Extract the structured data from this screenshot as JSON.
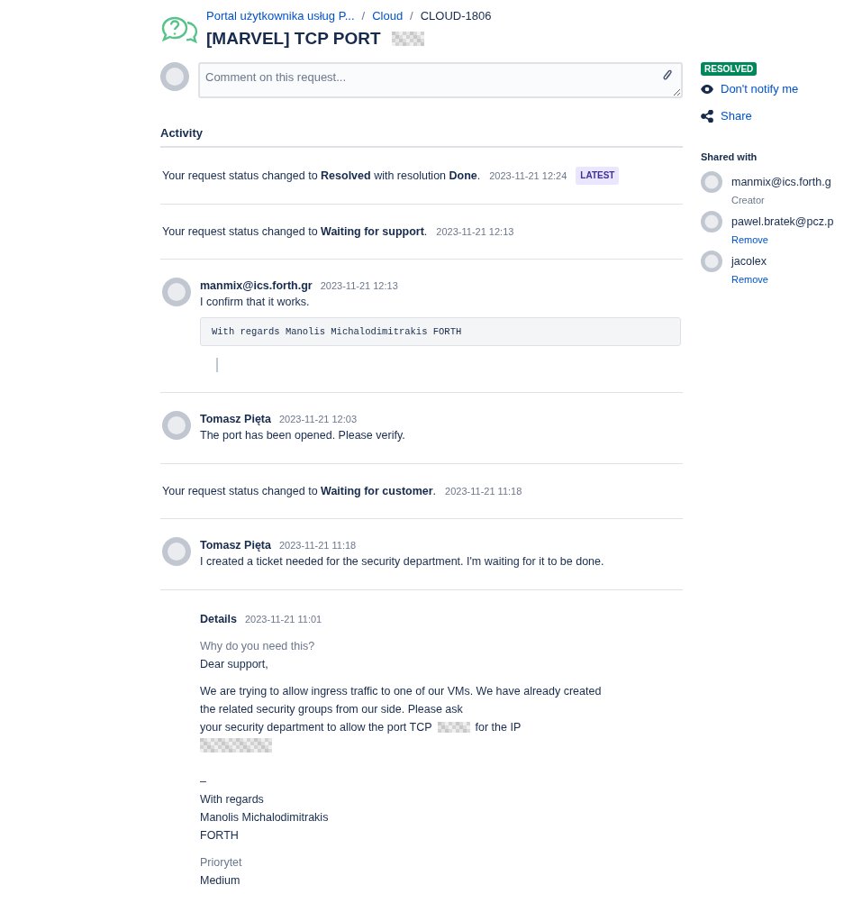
{
  "breadcrumb": [
    {
      "kind": "link",
      "label": "Portal użytkownika usług P..."
    },
    {
      "kind": "separator",
      "label": "/"
    },
    {
      "kind": "link",
      "label": "Cloud"
    },
    {
      "kind": "separator",
      "label": "/"
    },
    {
      "kind": "current",
      "label": "CLOUD-1806"
    }
  ],
  "title": {
    "text": "[MARVEL] TCP PORT",
    "redacted": true
  },
  "comment_field": {
    "placeholder": "Comment on this request..."
  },
  "activity": {
    "heading": "Activity",
    "items": [
      {
        "kind": "status",
        "text": "Your request status changed to **Resolved** with resolution **Done**.",
        "time": "2023-11-21 12:24",
        "badge": "LATEST"
      },
      {
        "kind": "status",
        "text": "Your request status changed to **Waiting for support**.",
        "time": "2023-11-21 12:13"
      },
      {
        "kind": "comment",
        "author": "manmix@ics.forth.gr",
        "time": "2023-11-21 12:13",
        "body": "I confirm that it works.",
        "quote": "With regards Manolis Michalodimitrakis FORTH"
      },
      {
        "kind": "comment",
        "author": "Tomasz Pięta",
        "time": "2023-11-21 12:03",
        "body": "The port has been opened. Please verify."
      },
      {
        "kind": "status",
        "text": "Your request status changed to **Waiting for customer**.",
        "time": "2023-11-21 11:18"
      },
      {
        "kind": "comment",
        "author": "Tomasz Pięta",
        "time": "2023-11-21 11:18",
        "body": "I created a ticket needed for the security department. I'm waiting for it to be done."
      },
      {
        "kind": "details",
        "heading": "Details",
        "time": "2023-11-21 11:01",
        "fields": [
          {
            "label": "Why do you need this?",
            "blocks": [
              {
                "kind": "line",
                "text": "Dear support,"
              },
              {
                "kind": "paragraph",
                "lines": [
                  [
                    {
                      "kind": "text",
                      "text": "We are trying to allow ingress traffic to one of our VMs. We have already created the related security groups from our side. Please ask"
                    }
                  ],
                  [
                    {
                      "kind": "text",
                      "text": "your security department to allow the port TCP"
                    },
                    {
                      "kind": "redacted"
                    },
                    {
                      "kind": "text",
                      "text": "for the IP"
                    }
                  ],
                  [
                    {
                      "kind": "redacted_line"
                    }
                  ]
                ]
              },
              {
                "kind": "gap_line",
                "text": "–"
              },
              {
                "kind": "line",
                "text": "With regards"
              },
              {
                "kind": "line",
                "text": "Manolis Michalodimitrakis"
              },
              {
                "kind": "line",
                "text": "FORTH"
              }
            ]
          },
          {
            "label": "Priorytet",
            "blocks": [
              {
                "kind": "line",
                "text": "Medium"
              }
            ]
          }
        ]
      }
    ]
  },
  "sidebar": {
    "status": "RESOLVED",
    "actions": [
      {
        "kind": "notify",
        "label": "Don't notify me"
      },
      {
        "kind": "share",
        "label": "Share"
      }
    ],
    "shared_heading": "Shared with",
    "people": [
      {
        "name": "manmix@ics.forth.g",
        "note": {
          "kind": "role",
          "text": "Creator"
        }
      },
      {
        "name": "pawel.bratek@pcz.p",
        "note": {
          "kind": "action",
          "text": "Remove"
        }
      },
      {
        "name": "jacolex",
        "note": {
          "kind": "action",
          "text": "Remove"
        }
      }
    ]
  }
}
